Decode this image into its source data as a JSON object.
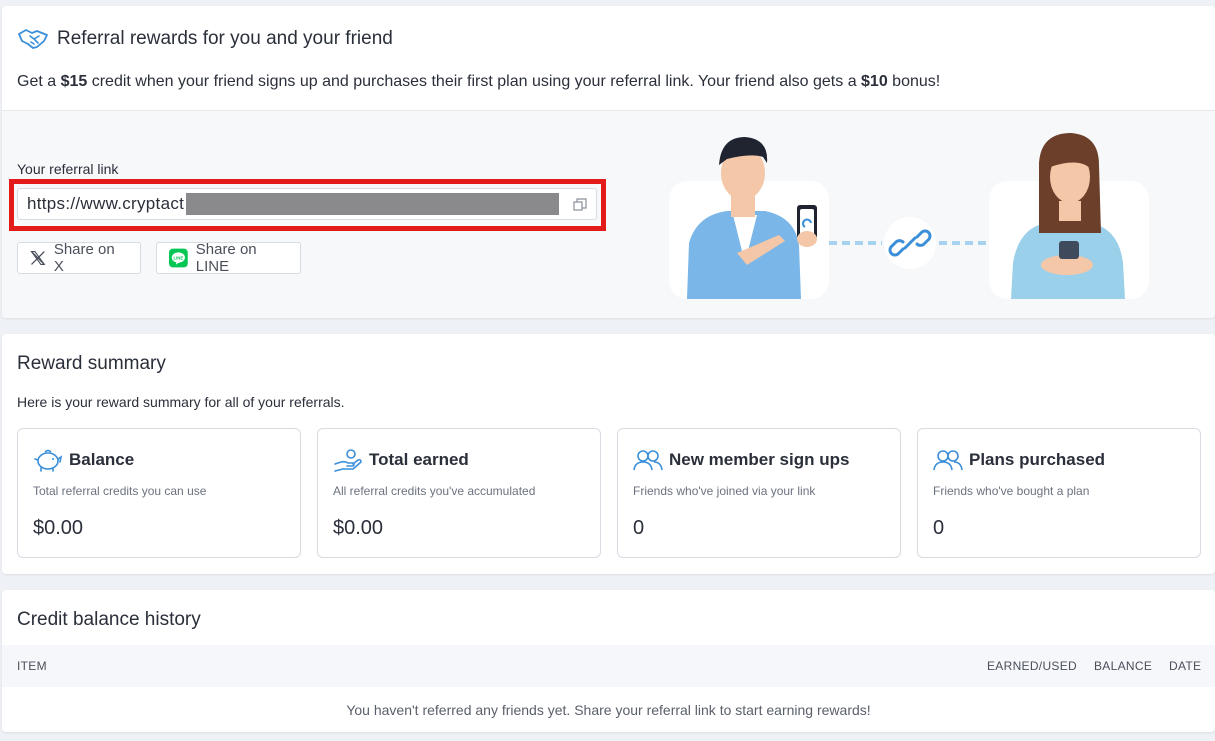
{
  "referral": {
    "title": "Referral rewards for you and your friend",
    "desc_prefix": "Get a ",
    "credit_amount": "$15",
    "desc_middle": " credit when your friend signs up and purchases their first plan using your referral link. Your friend also gets a ",
    "bonus_amount": "$10",
    "desc_suffix": " bonus!",
    "link_label": "Your referral link",
    "link_value": "https://www.cryptact",
    "share_x_label": "Share on X",
    "share_line_label": "Share on LINE"
  },
  "summary": {
    "title": "Reward summary",
    "desc": "Here is your reward summary for all of your referrals.",
    "stats": [
      {
        "title": "Balance",
        "desc": "Total referral credits you can use",
        "value": "$0.00",
        "icon": "piggy-bank-icon"
      },
      {
        "title": "Total earned",
        "desc": "All referral credits you've accumulated",
        "value": "$0.00",
        "icon": "hand-coin-icon"
      },
      {
        "title": "New member sign ups",
        "desc": "Friends who've joined via your link",
        "value": "0",
        "icon": "users-icon"
      },
      {
        "title": "Plans purchased",
        "desc": "Friends who've bought a plan",
        "value": "0",
        "icon": "users-icon"
      }
    ]
  },
  "history": {
    "title": "Credit balance history",
    "columns": [
      "ITEM",
      "EARNED/USED",
      "BALANCE",
      "DATE"
    ],
    "empty_message": "You haven't referred any friends yet. Share your referral link to start earning rewards!"
  },
  "colors": {
    "accent": "#3b8fd9",
    "highlight_border": "#e31b1b",
    "line_green": "#06c755"
  }
}
